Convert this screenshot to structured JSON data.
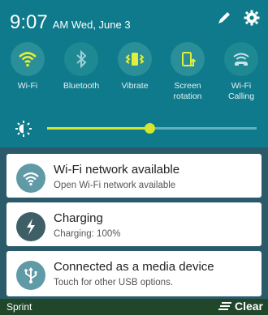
{
  "status": {
    "time": "9:07",
    "date": "AM Wed, June 3"
  },
  "quick_settings": [
    {
      "label": "Wi-Fi",
      "icon": "wifi-icon",
      "state": "on"
    },
    {
      "label": "Bluetooth",
      "icon": "bluetooth-icon",
      "state": "off"
    },
    {
      "label": "Vibrate",
      "icon": "vibrate-icon",
      "state": "on"
    },
    {
      "label": "Screen\nrotation",
      "icon": "screen-rotation-icon",
      "state": "on"
    },
    {
      "label": "Wi-Fi\nCalling",
      "icon": "wifi-calling-icon",
      "state": "off"
    }
  ],
  "brightness": {
    "level": 0.49
  },
  "notifications": [
    {
      "title": "Wi-Fi network available",
      "sub": "Open Wi-Fi network available",
      "icon": "wifi-notification-icon"
    },
    {
      "title": "Charging",
      "sub": "Charging: 100%",
      "icon": "charging-icon"
    },
    {
      "title": "Connected as a media device",
      "sub": "Touch for other USB options.",
      "icon": "usb-icon"
    }
  ],
  "footer": {
    "carrier": "Sprint",
    "clear_label": "Clear"
  },
  "colors": {
    "panel": "#0e7a8c",
    "accent": "#d6e62d",
    "icon_bg": "#3e5f66"
  }
}
